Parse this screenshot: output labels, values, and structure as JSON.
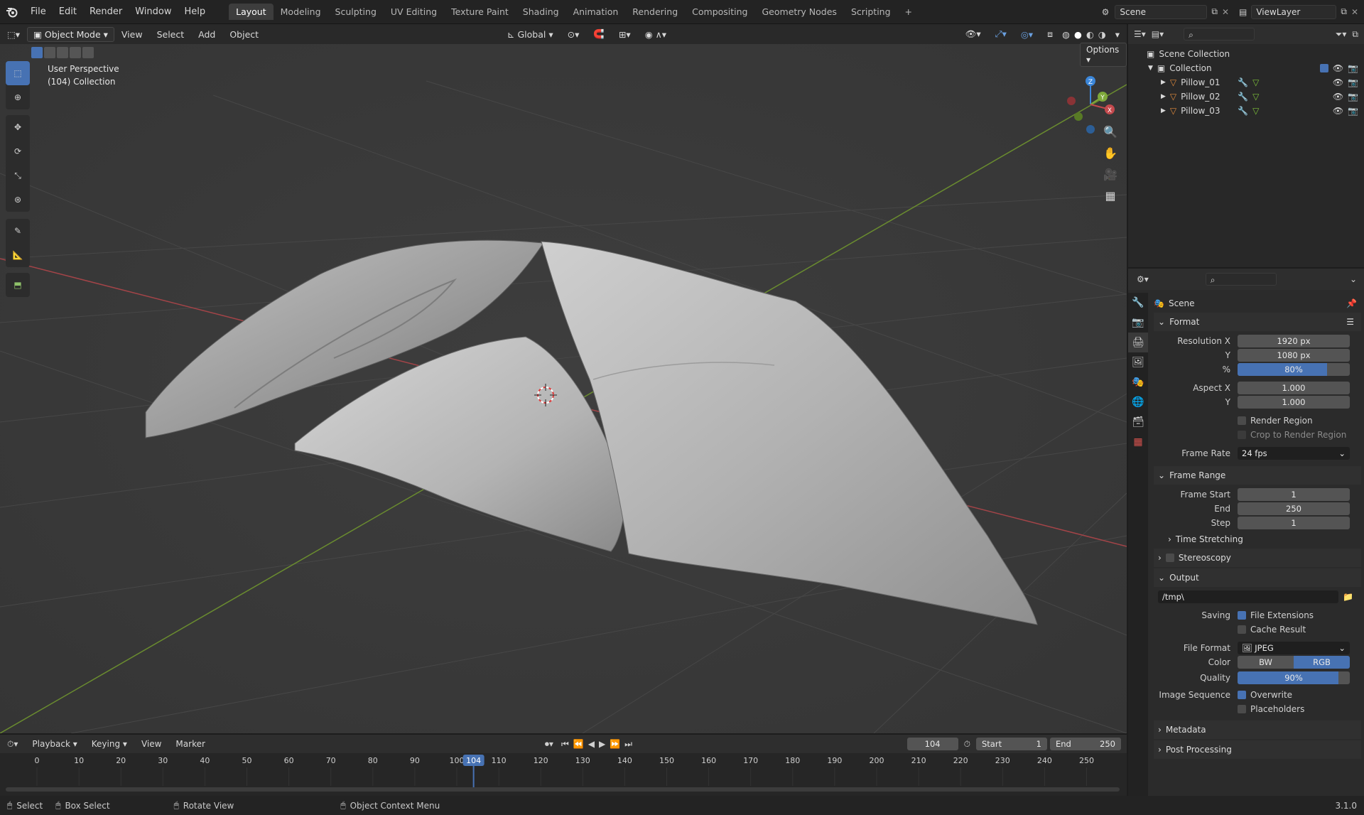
{
  "app": {
    "menus": [
      "File",
      "Edit",
      "Render",
      "Window",
      "Help"
    ],
    "workspaces": [
      "Layout",
      "Modeling",
      "Sculpting",
      "UV Editing",
      "Texture Paint",
      "Shading",
      "Animation",
      "Rendering",
      "Compositing",
      "Geometry Nodes",
      "Scripting"
    ],
    "active_workspace": "Layout",
    "add_tab": "+",
    "scene_name": "Scene",
    "view_layer": "ViewLayer",
    "version": "3.1.0"
  },
  "viewport": {
    "mode": "Object Mode",
    "menus": [
      "View",
      "Select",
      "Add",
      "Object"
    ],
    "orientation": "Global",
    "options_label": "Options",
    "overlay_title": "User Perspective",
    "overlay_subtitle": "(104) Collection",
    "gizmo_labels": {
      "z": "Z",
      "y": "Y",
      "x": "X"
    }
  },
  "outliner": {
    "root": "Scene Collection",
    "collection": "Collection",
    "objects": [
      "Pillow_01",
      "Pillow_02",
      "Pillow_03"
    ]
  },
  "properties": {
    "context": "Scene",
    "format": {
      "title": "Format",
      "res_x_label": "Resolution X",
      "res_x": "1920 px",
      "res_y_label": "Y",
      "res_y": "1080 px",
      "pct_label": "%",
      "pct": "80%",
      "pct_value": 0.8,
      "aspect_x_label": "Aspect X",
      "aspect_x": "1.000",
      "aspect_y_label": "Y",
      "aspect_y": "1.000",
      "render_region": "Render Region",
      "crop_region": "Crop to Render Region",
      "frame_rate_label": "Frame Rate",
      "frame_rate": "24 fps"
    },
    "frame_range": {
      "title": "Frame Range",
      "start_label": "Frame Start",
      "start": "1",
      "end_label": "End",
      "end": "250",
      "step_label": "Step",
      "step": "1",
      "time_stretching": "Time Stretching"
    },
    "stereoscopy": "Stereoscopy",
    "output": {
      "title": "Output",
      "path": "/tmp\\",
      "saving_label": "Saving",
      "file_extensions": "File Extensions",
      "cache_result": "Cache Result",
      "file_format_label": "File Format",
      "file_format": "JPEG",
      "color_label": "Color",
      "color_bw": "BW",
      "color_rgb": "RGB",
      "quality_label": "Quality",
      "quality": "90%",
      "quality_value": 0.9,
      "image_sequence_label": "Image Sequence",
      "overwrite": "Overwrite",
      "placeholders": "Placeholders"
    },
    "metadata": "Metadata",
    "post_processing": "Post Processing"
  },
  "timeline": {
    "menus": [
      "Playback",
      "Keying",
      "View",
      "Marker"
    ],
    "current_frame": "104",
    "start_label": "Start",
    "start": "1",
    "end_label": "End",
    "end": "250",
    "ticks": [
      "0",
      "10",
      "20",
      "30",
      "40",
      "50",
      "60",
      "70",
      "80",
      "90",
      "100",
      "110",
      "120",
      "130",
      "140",
      "150",
      "160",
      "170",
      "180",
      "190",
      "200",
      "210",
      "220",
      "230",
      "240",
      "250"
    ]
  },
  "statusbar": {
    "select": "Select",
    "box_select": "Box Select",
    "rotate_view": "Rotate View",
    "context_menu": "Object Context Menu"
  },
  "colors": {
    "accent": "#4772b3",
    "x_axis": "#c4494d",
    "y_axis": "#7ea83a",
    "z_axis": "#3b86d9",
    "object_icon": "#e08a3c"
  }
}
